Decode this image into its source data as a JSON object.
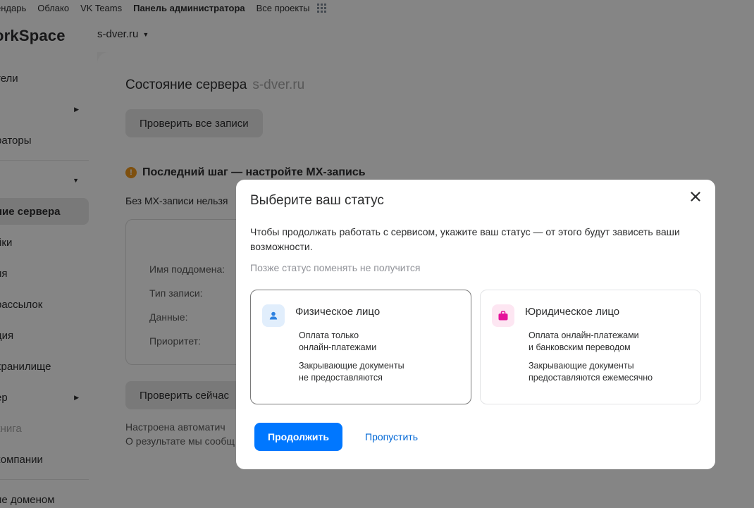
{
  "topnav": {
    "items": [
      "endarь",
      "Облако",
      "VK Teams",
      "Панель администратора",
      "Все проекты"
    ],
    "calendar": "ендарь",
    "cloud": "Облако",
    "teams": "VK Teams",
    "admin": "Панель администратора",
    "projects": "Все проекты",
    "apps_icon": "apps-grid-icon"
  },
  "header": {
    "logo": "orkSpace",
    "domain": "s-dver.ru"
  },
  "sidebar": {
    "items": [
      {
        "label": "тели"
      },
      {
        "label": ""
      },
      {
        "label": "раторы"
      },
      {
        "label": ""
      },
      {
        "label": "ние сервера"
      },
      {
        "label": "йки"
      },
      {
        "label": "ия"
      },
      {
        "label": "рассылок"
      },
      {
        "label": "ция"
      },
      {
        "label": " хранилище"
      },
      {
        "label": "ер"
      },
      {
        "label": "книга"
      },
      {
        "label": " компании"
      },
      {
        "label": "ие доменом"
      }
    ]
  },
  "main": {
    "title": "Состояние сервера",
    "title_domain": "s-dver.ru",
    "check_all": "Проверить все записи",
    "warning_title": "Последний шаг — настройте MX-запись",
    "warning_icon": "!",
    "warning_desc": "Без MX-записи нельзя",
    "dns_labels": [
      "Имя поддомена:",
      "Тип записи:",
      "Данные:",
      "Приоритет:"
    ],
    "check_now": "Проверить сейчас",
    "footer_lines": [
      "Настроена автоматич",
      "О результате мы сообщ"
    ]
  },
  "modal": {
    "title": "Выберите ваш статус",
    "description": "Чтобы продолжать работать с сервисом, укажите ваш статус — от этого будут зависеть ваши возможности.",
    "hint": "Позже статус поменять не получится",
    "options": [
      {
        "title": "Физическое лицо",
        "line1": "Оплата только\nонлайн-платежами",
        "line2": "Закрывающие документы\nне предоставляются",
        "icon": "person-icon",
        "selected": true
      },
      {
        "title": "Юридическое лицо",
        "line1": "Оплата онлайн-платежами\nи банковским переводом",
        "line2": "Закрывающие документы\nпредоставляются ежемесячно",
        "icon": "briefcase-icon",
        "selected": false
      }
    ],
    "continue": "Продолжить",
    "skip": "Пропустить"
  },
  "colors": {
    "primary": "#0077ff",
    "link": "#0067d6",
    "warning": "#f29a1d",
    "person_icon_bg": "#e1eefc",
    "person_icon": "#2d81e0",
    "briefcase_icon_bg": "#fde6f2",
    "briefcase_icon": "#e5129a"
  }
}
